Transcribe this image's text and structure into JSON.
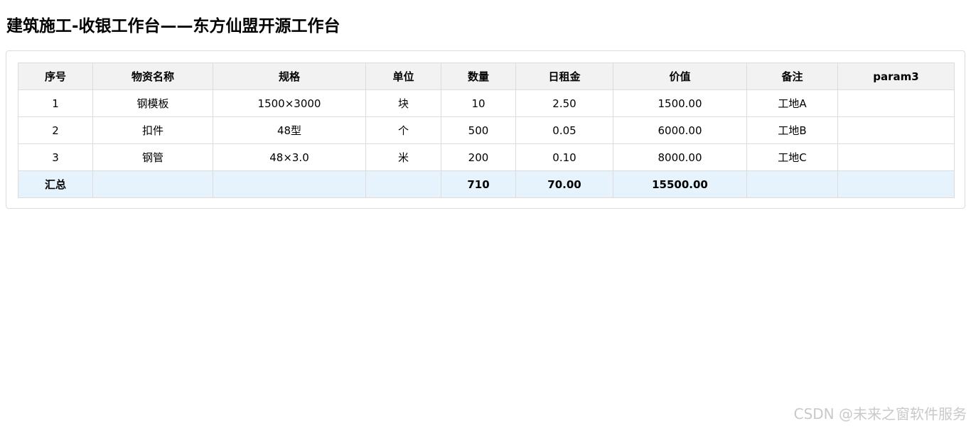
{
  "page": {
    "title": "建筑施工-收银工作台——东方仙盟开源工作台"
  },
  "table": {
    "headers": [
      "序号",
      "物资名称",
      "规格",
      "单位",
      "数量",
      "日租金",
      "价值",
      "备注",
      "param3"
    ],
    "rows": [
      [
        "1",
        "钢模板",
        "1500×3000",
        "块",
        "10",
        "2.50",
        "1500.00",
        "工地A",
        ""
      ],
      [
        "2",
        "扣件",
        "48型",
        "个",
        "500",
        "0.05",
        "6000.00",
        "工地B",
        ""
      ],
      [
        "3",
        "钢管",
        "48×3.0",
        "米",
        "200",
        "0.10",
        "8000.00",
        "工地C",
        ""
      ]
    ],
    "summary": [
      "汇总",
      "",
      "",
      "",
      "710",
      "70.00",
      "15500.00",
      "",
      ""
    ]
  },
  "watermark": {
    "text": "CSDN @未来之窗软件服务"
  },
  "colors": {
    "header_bg": "#f2f2f2",
    "summary_bg": "#e6f3fd",
    "border": "#dcdcdc"
  }
}
